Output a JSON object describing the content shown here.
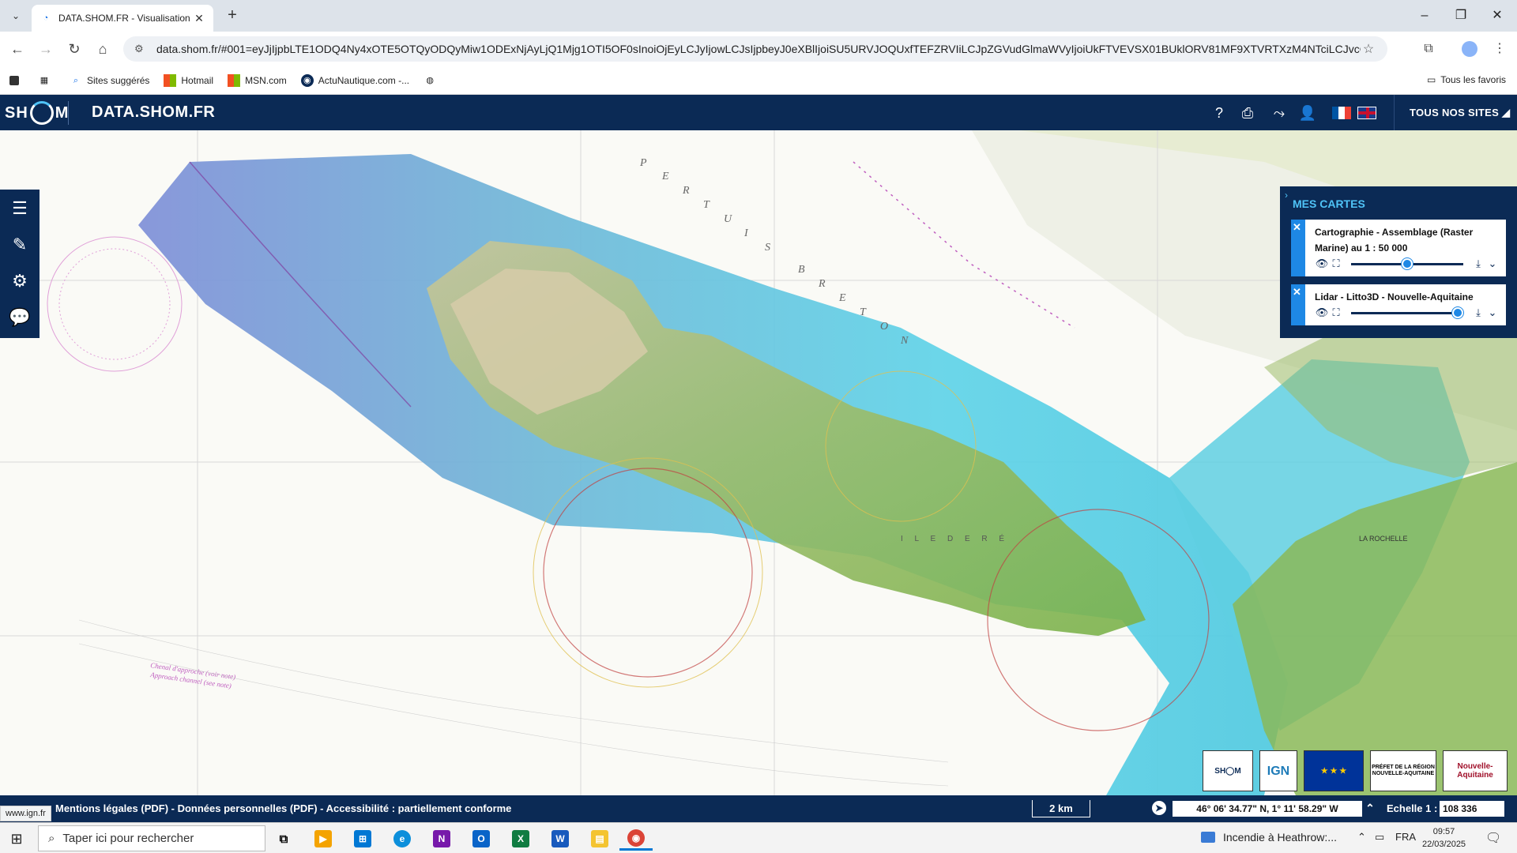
{
  "browser": {
    "tab_title": "DATA.SHOM.FR - Visualisation c",
    "url": "data.shom.fr/#001=eyJjIjpbLTE1ODQ4Ny4xOTE5OTQyODQyMiw1ODExNjAyLjQ1Mjg1OTI5OF0sInoiOjEyLCJyIjowLCJsIjpbeyJ0eXBlIjoiSU5URVJOQUxfTEFZRVIiLCJpZGVudGlmaWVyIjoiUkFTVEVSX01BUklORV81MF9XTVRTXzM4NTciLCJvcGFjaXR5IjowLjUs...",
    "bookmarks": [
      {
        "label": "Sites suggérés",
        "icon": "search-icon"
      },
      {
        "label": "Hotmail",
        "icon": "windows-icon"
      },
      {
        "label": "MSN.com",
        "icon": "windows-icon"
      },
      {
        "label": "ActuNautique.com -...",
        "icon": "actunautique-icon"
      }
    ],
    "all_bookmarks": "Tous les favoris"
  },
  "header": {
    "logo_text_left": "SH",
    "logo_text_right": "M",
    "title": "DATA.SHOM.FR",
    "all_sites": "TOUS NOS SITES"
  },
  "panel": {
    "title": "MES CARTES",
    "layers": [
      {
        "name": "Cartographie - Assemblage (Raster Marine) au 1 : 50 000",
        "opacity": 0.5
      },
      {
        "name": "Lidar - Litto3D - Nouvelle-Aquitaine",
        "opacity": 0.95
      }
    ]
  },
  "map": {
    "labels": {
      "pertuis_breton": [
        "P",
        "E",
        "R",
        "T",
        "U",
        "I",
        "S",
        "B",
        "R",
        "E",
        "T",
        "O",
        "N"
      ],
      "ile_de_re": "I L E   D E   R É",
      "la_rochelle": "LA ROCHELLE",
      "chenal": "Chenal d'approche (voir note)",
      "approach": "Approach channel (see note)"
    }
  },
  "logos": [
    {
      "name": "SHOM",
      "text": "SH◯M"
    },
    {
      "name": "IGN",
      "text": "IGN"
    },
    {
      "name": "EU",
      "text": "★ ★ ★"
    },
    {
      "name": "Prefet",
      "text": "PRÉFET DE LA RÉGION NOUVELLE-AQUITAINE"
    },
    {
      "name": "Nouvelle-Aquitaine",
      "text": "Nouvelle-Aquitaine"
    }
  ],
  "footer": {
    "legal": "Mentions légales (PDF) - Données personnelles (PDF) - Accessibilité : partiellement conforme",
    "scale_bar": "2 km",
    "coords": "46° 06' 34.77\" N, 1° 11' 58.29\" W",
    "scale_label": "Echelle 1 :",
    "scale_value": "108 336",
    "status_url": "www.ign.fr"
  },
  "taskbar": {
    "search_placeholder": "Taper ici pour rechercher",
    "news": "Incendie à Heathrow:...",
    "lang": "FRA",
    "time": "09:57",
    "date": "22/03/2025"
  }
}
